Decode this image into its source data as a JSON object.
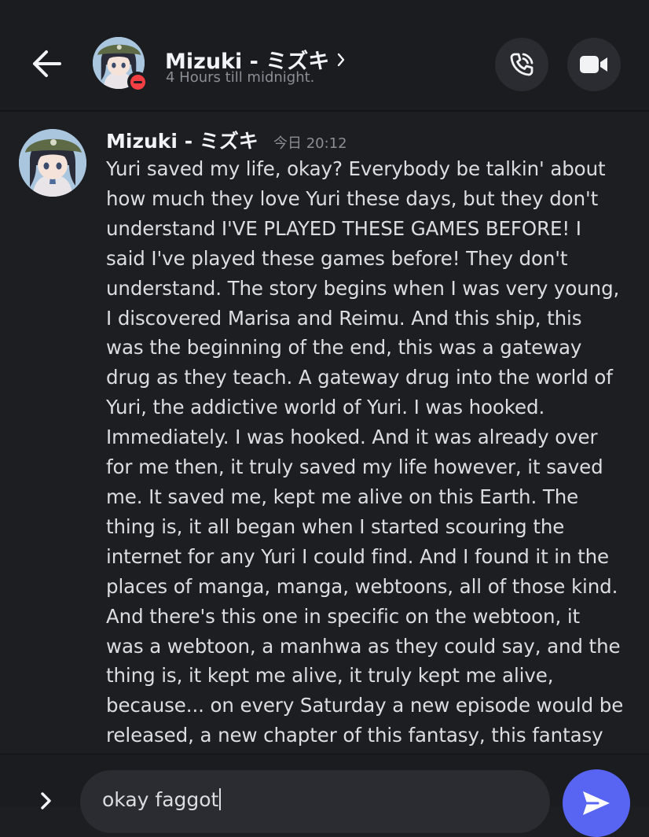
{
  "header": {
    "back_icon": "arrow-left-icon",
    "name": "Mizuki - ミズキ",
    "chevron_icon": "chevron-right-icon",
    "status": "4 Hours till midnight.",
    "presence": "do-not-disturb",
    "call_icon": "phone-call-icon",
    "video_icon": "video-camera-icon"
  },
  "message": {
    "author": "Mizuki - ミズキ",
    "timestamp": "今日 20:12",
    "lines": [
      "Yuri saved my life, okay? Everybody be talkin' about",
      "how much they love Yuri these days, but they don't",
      "understand I'VE PLAYED THESE GAMES BEFORE! I",
      "said I've played these games before! They don't",
      "understand. The story begins when I was very young,",
      "I discovered Marisa and Reimu. And this ship, this",
      "was the beginning of the end, this was a gateway",
      "drug as they teach. A gateway drug into the world of",
      "Yuri, the addictive world of Yuri. I was hooked.",
      "Immediately. I was hooked. And it was already over",
      "for me then, it truly saved my life however, it saved",
      "me. It saved me, kept me alive on this Earth. The",
      "thing is, it all began when I started scouring the",
      "internet for any Yuri I could find. And I found it in the",
      "places of manga, manga, webtoons, all of those kind.",
      "And there's this one in specific on the webtoon, it",
      "was a webtoon, a manhwa as they could say, and the",
      "thing is, it kept me alive, it truly kept me alive,",
      "because... on every Saturday a new episode would be",
      "released, a new chapter of this fantasy, this fantasy"
    ]
  },
  "composer": {
    "expand_icon": "chevron-right-icon",
    "input_value": "okay faggot",
    "emoji_icon": "emoji-smile-icon",
    "send_icon": "send-arrow-icon"
  },
  "colors": {
    "background": "#1d1e22",
    "header_bg": "#1b1c20",
    "accent": "#5865f2",
    "dnd_red": "#f23f43",
    "muted_text": "#8a8e95"
  }
}
